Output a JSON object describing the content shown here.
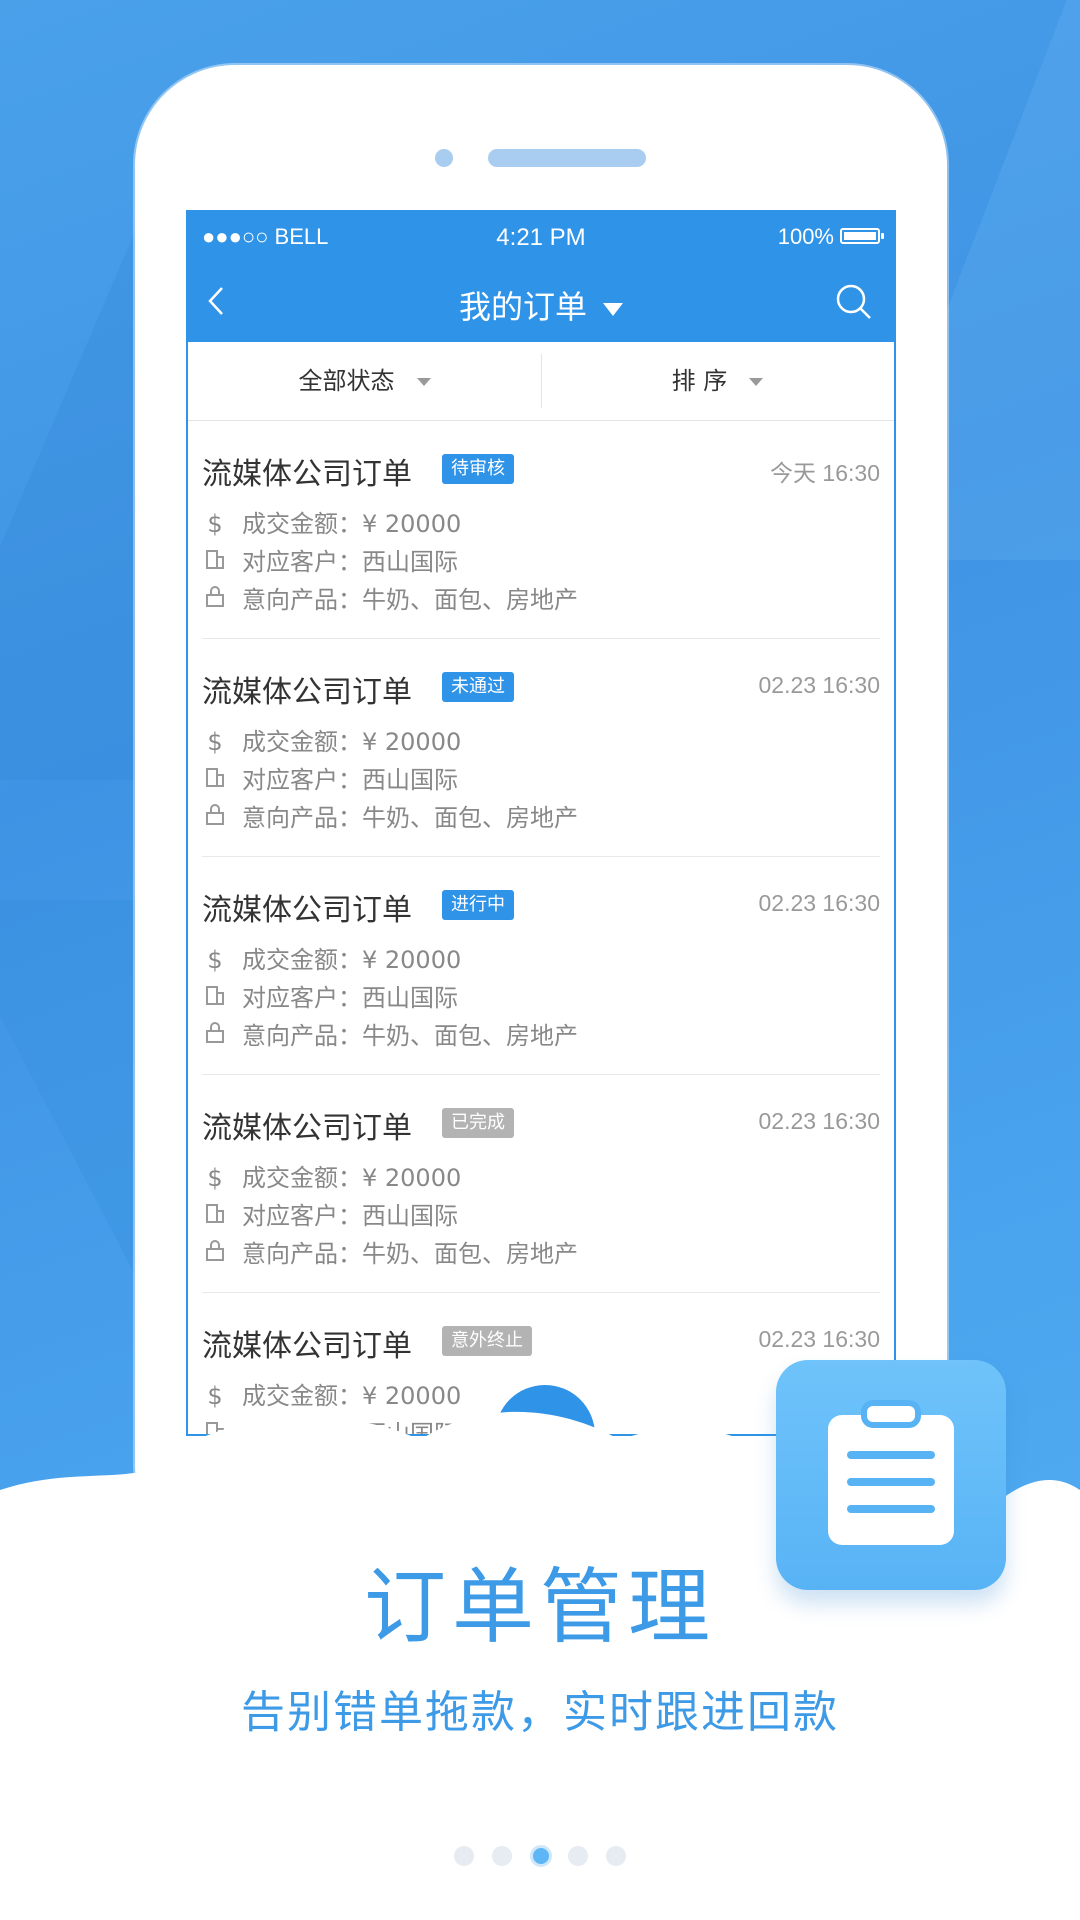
{
  "colors": {
    "brand": "#2f93e8",
    "accent_text": "#3d9ae6",
    "badge_blue": "#2f93e8",
    "badge_gray": "#b3b3b3"
  },
  "status_bar": {
    "signal": "●●●○○ BELL",
    "time": "4:21 PM",
    "battery": "100%"
  },
  "nav": {
    "title": "我的订单",
    "back_icon": "chevron-left-icon",
    "search_icon": "search-icon"
  },
  "filters": [
    {
      "label": "全部状态"
    },
    {
      "label": "排 序"
    }
  ],
  "orders": [
    {
      "name": "流媒体公司订单",
      "status": "待审核",
      "status_color": "blue",
      "time": "今天 16:30",
      "amount": "成交金额：¥ 20000",
      "customer": "对应客户：西山国际",
      "product": "意向产品：牛奶、面包、房地产"
    },
    {
      "name": "流媒体公司订单",
      "status": "未通过",
      "status_color": "blue",
      "time": "02.23 16:30",
      "amount": "成交金额：¥ 20000",
      "customer": "对应客户：西山国际",
      "product": "意向产品：牛奶、面包、房地产"
    },
    {
      "name": "流媒体公司订单",
      "status": "进行中",
      "status_color": "blue",
      "time": "02.23 16:30",
      "amount": "成交金额：¥ 20000",
      "customer": "对应客户：西山国际",
      "product": "意向产品：牛奶、面包、房地产"
    },
    {
      "name": "流媒体公司订单",
      "status": "已完成",
      "status_color": "gray",
      "time": "02.23 16:30",
      "amount": "成交金额：¥ 20000",
      "customer": "对应客户：西山国际",
      "product": "意向产品：牛奶、面包、房地产"
    },
    {
      "name": "流媒体公司订单",
      "status": "意外终止",
      "status_color": "gray",
      "time": "02.23 16:30",
      "amount": "成交金额：¥ 20000",
      "customer": "对应客户：西山国际",
      "product": ""
    }
  ],
  "row_icons": {
    "amount": "$",
    "customer": "building-icon",
    "product": "bag-icon"
  },
  "promo": {
    "headline": "订单管理",
    "subtitle": "告别错单拖款，实时跟进回款"
  },
  "pager": {
    "count": 5,
    "active": 3
  }
}
